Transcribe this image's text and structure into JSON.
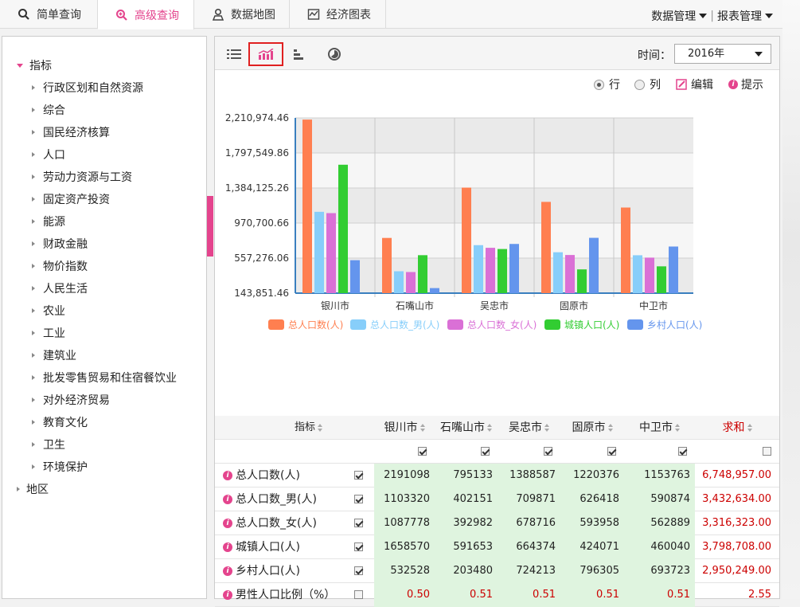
{
  "nav": {
    "tabs": [
      {
        "label": "简单查询",
        "icon": "search-icon"
      },
      {
        "label": "高级查询",
        "icon": "zoom-plus-icon"
      },
      {
        "label": "数据地图",
        "icon": "map-person-icon"
      },
      {
        "label": "经济图表",
        "icon": "chart-frame-icon"
      }
    ],
    "data_mgmt": "数据管理",
    "report_mgmt": "报表管理",
    "active_color": "#e4448d"
  },
  "sidebar": {
    "root": "指标",
    "items": [
      "行政区划和自然资源",
      "综合",
      "国民经济核算",
      "人口",
      "劳动力资源与工资",
      "固定资产投资",
      "能源",
      "财政金融",
      "物价指数",
      "人民生活",
      "农业",
      "工业",
      "建筑业",
      "批发零售贸易和住宿餐饮业",
      "对外经济贸易",
      "教育文化",
      "卫生",
      "环境保护"
    ],
    "other_root": "地区"
  },
  "toolbar": {
    "icons": [
      "list-icon",
      "line-chart-icon",
      "bar-chart-icon",
      "pie-chart-icon"
    ],
    "time_label": "时间：",
    "time_value": "2016年"
  },
  "options": {
    "row": "行",
    "col": "列",
    "edit": "编辑",
    "hint": "提示"
  },
  "chart_data": {
    "type": "bar",
    "categories": [
      "银川市",
      "石嘴山市",
      "吴忠市",
      "固原市",
      "中卫市"
    ],
    "series": [
      {
        "name": "总人口数(人)",
        "color": "#ff7f50",
        "values": [
          2191098,
          795133,
          1388587,
          1220376,
          1153763
        ]
      },
      {
        "name": "总人口数_男(人)",
        "color": "#87cefa",
        "values": [
          1103320,
          402151,
          709871,
          626418,
          590874
        ]
      },
      {
        "name": "总人口数_女(人)",
        "color": "#da70d6",
        "values": [
          1087778,
          392982,
          678716,
          593958,
          562889
        ]
      },
      {
        "name": "城镇人口(人)",
        "color": "#32cd32",
        "values": [
          1658570,
          591653,
          664374,
          424071,
          460040
        ]
      },
      {
        "name": "乡村人口(人)",
        "color": "#6495ed",
        "values": [
          532528,
          203480,
          724213,
          796305,
          693723
        ]
      }
    ],
    "yticks": [
      "143,851.46",
      "557,276.06",
      "970,700.66",
      "1,384,125.26",
      "1,797,549.86",
      "2,210,974.46"
    ],
    "ylim": [
      143851.46,
      2210974.46
    ],
    "legend_position": "bottom"
  },
  "table": {
    "header": {
      "indicator": "指标",
      "sum": "求和"
    },
    "columns": [
      "银川市",
      "石嘴山市",
      "吴忠市",
      "固原市",
      "中卫市"
    ],
    "col_checked": [
      true,
      true,
      true,
      true,
      true
    ],
    "sum_checked": false,
    "rows": [
      {
        "label": "总人口数(人)",
        "checked": true,
        "values": [
          "2191098",
          "795133",
          "1388587",
          "1220376",
          "1153763"
        ],
        "sum": "6,748,957.00"
      },
      {
        "label": "总人口数_男(人)",
        "checked": true,
        "values": [
          "1103320",
          "402151",
          "709871",
          "626418",
          "590874"
        ],
        "sum": "3,432,634.00"
      },
      {
        "label": "总人口数_女(人)",
        "checked": true,
        "values": [
          "1087778",
          "392982",
          "678716",
          "593958",
          "562889"
        ],
        "sum": "3,316,323.00"
      },
      {
        "label": "城镇人口(人)",
        "checked": true,
        "values": [
          "1658570",
          "591653",
          "664374",
          "424071",
          "460040"
        ],
        "sum": "3,798,708.00"
      },
      {
        "label": "乡村人口(人)",
        "checked": true,
        "values": [
          "532528",
          "203480",
          "724213",
          "796305",
          "693723"
        ],
        "sum": "2,950,249.00"
      },
      {
        "label": "男性人口比例（%）",
        "checked": false,
        "values": [
          "0.50",
          "0.51",
          "0.51",
          "0.51",
          "0.51"
        ],
        "sum": "2.55"
      }
    ]
  }
}
